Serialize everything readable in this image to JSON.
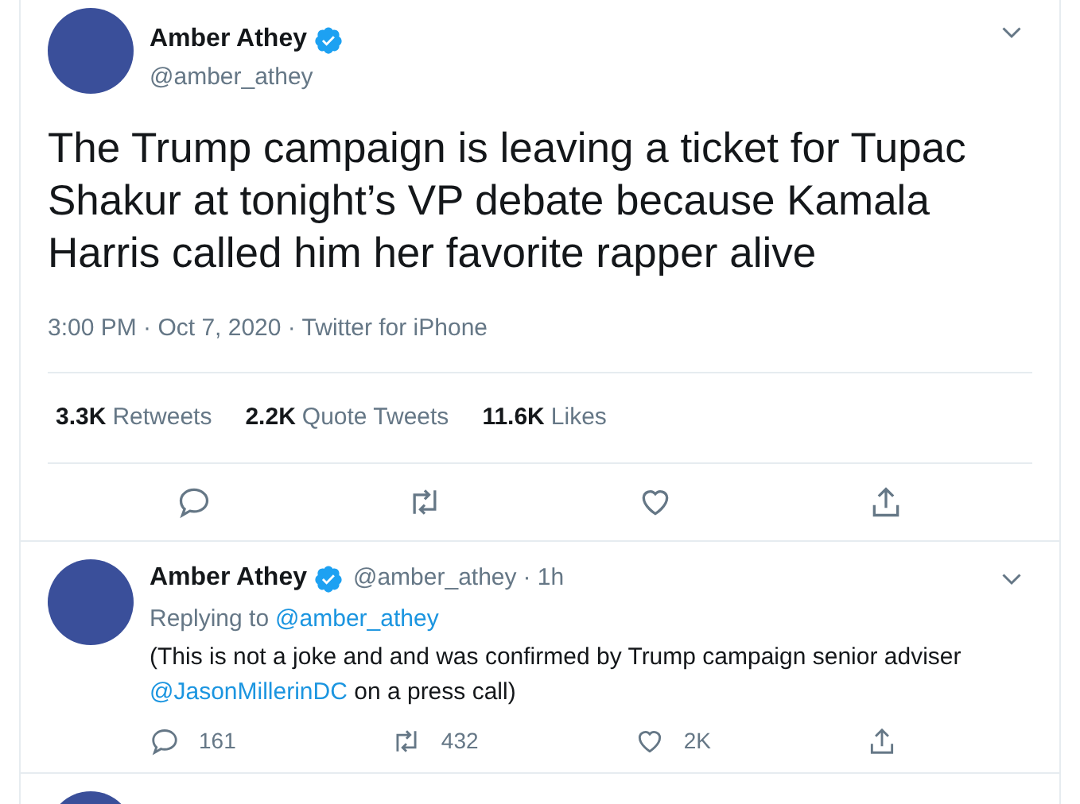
{
  "tweet": {
    "author": {
      "name": "Amber Athey",
      "handle": "@amber_athey",
      "verified": true
    },
    "text": "The Trump campaign is leaving a ticket for Tupac Shakur at tonight’s VP debate because Kamala Harris called him her favorite rapper alive",
    "meta": "3:00 PM · Oct 7, 2020 · Twitter for iPhone",
    "stats": [
      {
        "count": "3.3K",
        "label": "Retweets"
      },
      {
        "count": "2.2K",
        "label": "Quote Tweets"
      },
      {
        "count": "11.6K",
        "label": "Likes"
      }
    ]
  },
  "replies": [
    {
      "name": "Amber Athey",
      "verified": true,
      "handle": "@amber_athey",
      "time": "· 1h",
      "replying_label": "Replying to",
      "replying_to": "@amber_athey",
      "text": "(This is not a joke and and was confirmed by Trump campaign senior adviser",
      "mention": "@JasonMillerinDC",
      "text_end": "on a press call)",
      "replies": "161",
      "retweets": "432",
      "likes": "2K"
    }
  ]
}
